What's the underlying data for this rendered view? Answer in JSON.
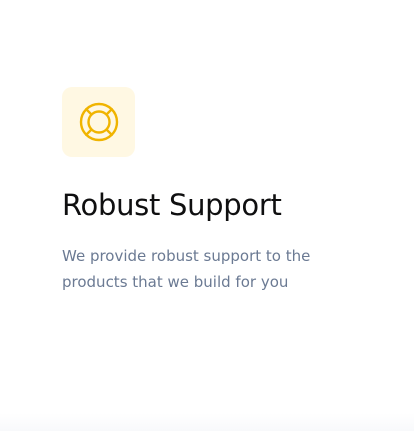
{
  "feature": {
    "icon": "life-ring-icon",
    "title": "Robust Support",
    "description": "We provide robust support to the products that we build for you"
  },
  "colors": {
    "background": "#ffffff",
    "icon_tile_background": "#fff8e3",
    "icon_color": "#f0b400",
    "title_color": "#0f0f10",
    "description_color": "#6b7a93"
  }
}
